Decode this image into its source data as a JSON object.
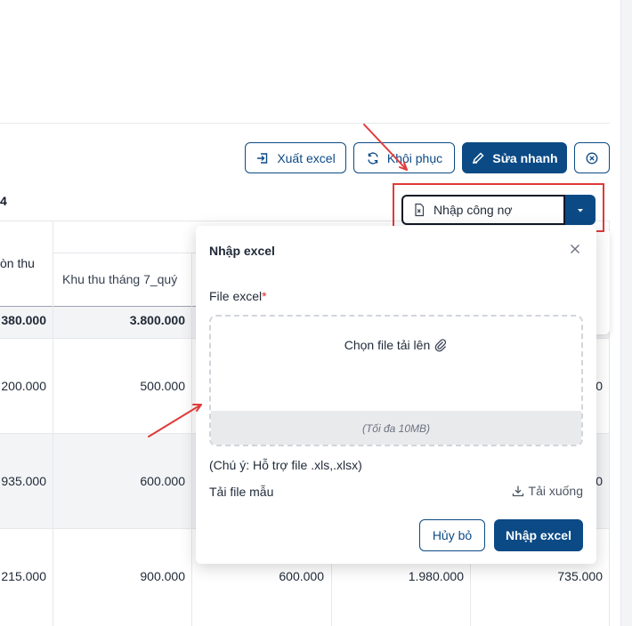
{
  "toolbar": {
    "export_label": "Xuất excel",
    "restore_label": "Khôi phục",
    "quick_edit_label": "Sửa nhanh"
  },
  "split_button": {
    "label": "Nhập công nợ"
  },
  "table": {
    "year_fragment": "4",
    "header_fragment": "òn thu",
    "header_col2": "Khu thu tháng 7_quý",
    "totals": [
      "380.000",
      "3.800.000"
    ],
    "rows": [
      [
        "200.000",
        "500.000",
        "",
        "",
        "0"
      ],
      [
        "935.000",
        "600.000",
        "",
        "",
        "0"
      ],
      [
        "215.000",
        "900.000",
        "600.000",
        "1.980.000",
        "735.000"
      ]
    ]
  },
  "modal": {
    "title": "Nhập excel",
    "field_label": "File excel",
    "required_mark": "*",
    "upload_text": "Chọn file tải lên",
    "max_size": "(Tối đa 10MB)",
    "note": "(Chú ý: Hỗ trợ file .xls,.xlsx)",
    "template_label": "Tải file mẫu",
    "download_label": "Tải xuống",
    "cancel_label": "Hủy bỏ",
    "submit_label": "Nhập excel"
  },
  "colors": {
    "primary": "#0b4a85",
    "annotation_red": "#e03a3a",
    "required": "#dc2626"
  },
  "icons": [
    "export-icon",
    "refresh-icon",
    "pencil-icon",
    "close-circle-icon",
    "excel-file-icon",
    "caret-down-icon",
    "close-icon",
    "paperclip-icon",
    "download-icon"
  ]
}
